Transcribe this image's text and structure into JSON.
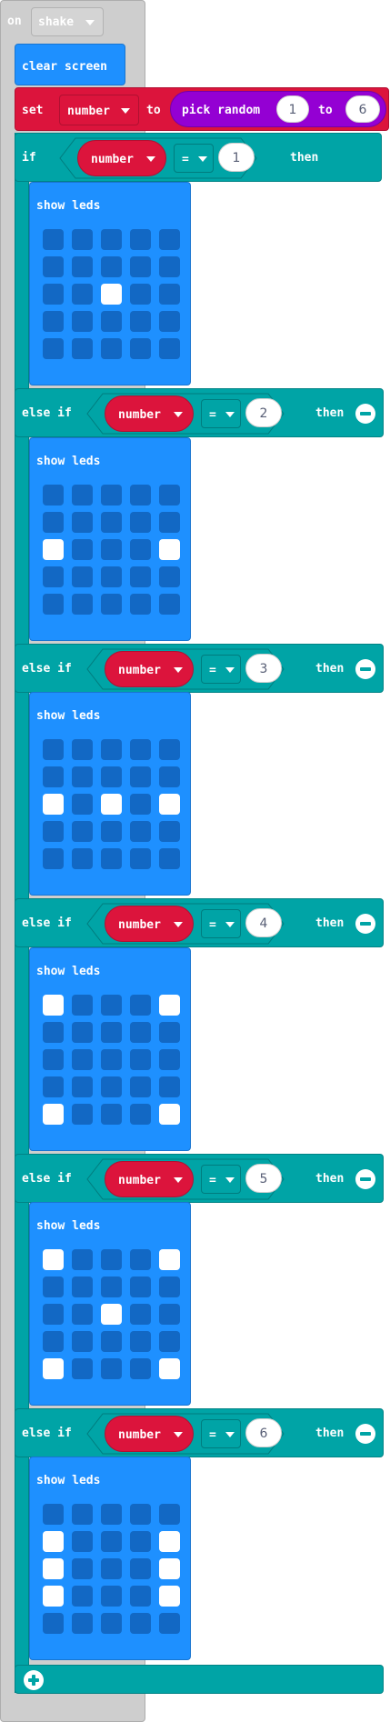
{
  "event": {
    "on_label": "on",
    "gesture": "shake"
  },
  "clear_screen": {
    "label": "clear screen"
  },
  "set_block": {
    "set_label": "set",
    "variable": "number",
    "to_label": "to",
    "pick_random_label": "pick random",
    "from_value": "1",
    "to2_label": "to",
    "to_value": "6"
  },
  "conditional": {
    "if_label": "if",
    "then_label": "then",
    "else_if_label": "else if",
    "show_leds_label": "show leds",
    "branches": [
      {
        "variable": "number",
        "operator": "=",
        "value": "1",
        "leds": [
          [
            0,
            0,
            0,
            0,
            0
          ],
          [
            0,
            0,
            0,
            0,
            0
          ],
          [
            0,
            0,
            1,
            0,
            0
          ],
          [
            0,
            0,
            0,
            0,
            0
          ],
          [
            0,
            0,
            0,
            0,
            0
          ]
        ]
      },
      {
        "variable": "number",
        "operator": "=",
        "value": "2",
        "leds": [
          [
            0,
            0,
            0,
            0,
            0
          ],
          [
            0,
            0,
            0,
            0,
            0
          ],
          [
            1,
            0,
            0,
            0,
            1
          ],
          [
            0,
            0,
            0,
            0,
            0
          ],
          [
            0,
            0,
            0,
            0,
            0
          ]
        ]
      },
      {
        "variable": "number",
        "operator": "=",
        "value": "3",
        "leds": [
          [
            0,
            0,
            0,
            0,
            0
          ],
          [
            0,
            0,
            0,
            0,
            0
          ],
          [
            1,
            0,
            1,
            0,
            1
          ],
          [
            0,
            0,
            0,
            0,
            0
          ],
          [
            0,
            0,
            0,
            0,
            0
          ]
        ]
      },
      {
        "variable": "number",
        "operator": "=",
        "value": "4",
        "leds": [
          [
            1,
            0,
            0,
            0,
            1
          ],
          [
            0,
            0,
            0,
            0,
            0
          ],
          [
            0,
            0,
            0,
            0,
            0
          ],
          [
            0,
            0,
            0,
            0,
            0
          ],
          [
            1,
            0,
            0,
            0,
            1
          ]
        ]
      },
      {
        "variable": "number",
        "operator": "=",
        "value": "5",
        "leds": [
          [
            1,
            0,
            0,
            0,
            1
          ],
          [
            0,
            0,
            0,
            0,
            0
          ],
          [
            0,
            0,
            1,
            0,
            0
          ],
          [
            0,
            0,
            0,
            0,
            0
          ],
          [
            1,
            0,
            0,
            0,
            1
          ]
        ]
      },
      {
        "variable": "number",
        "operator": "=",
        "value": "6",
        "leds": [
          [
            0,
            0,
            0,
            0,
            0
          ],
          [
            1,
            0,
            0,
            0,
            1
          ],
          [
            1,
            0,
            0,
            0,
            1
          ],
          [
            1,
            0,
            0,
            0,
            1
          ],
          [
            0,
            0,
            0,
            0,
            0
          ]
        ]
      }
    ]
  },
  "colors": {
    "event": "#cecece",
    "basic": "#1e90ff",
    "variables": "#dc143c",
    "math": "#9400d3",
    "logic": "#00a4a6",
    "led_off": "#1268c4",
    "led_on": "#ffffff"
  }
}
